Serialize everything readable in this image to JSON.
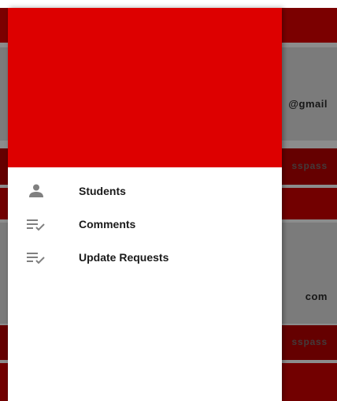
{
  "colors": {
    "header": "#dd0000",
    "app_bar_bg": "#e00000",
    "card_bg": "#e0e0e0",
    "button_bg": "#b80000",
    "icon_gray": "#808080"
  },
  "background": {
    "card1_text": "@gmail",
    "card1_button": "sspass",
    "card2_text": "com",
    "card2_button": "sspass"
  },
  "drawer": {
    "items": [
      {
        "label": "Students",
        "icon": "person-icon"
      },
      {
        "label": "Comments",
        "icon": "playlist-check-icon"
      },
      {
        "label": "Update Requests",
        "icon": "playlist-check-icon"
      }
    ]
  }
}
